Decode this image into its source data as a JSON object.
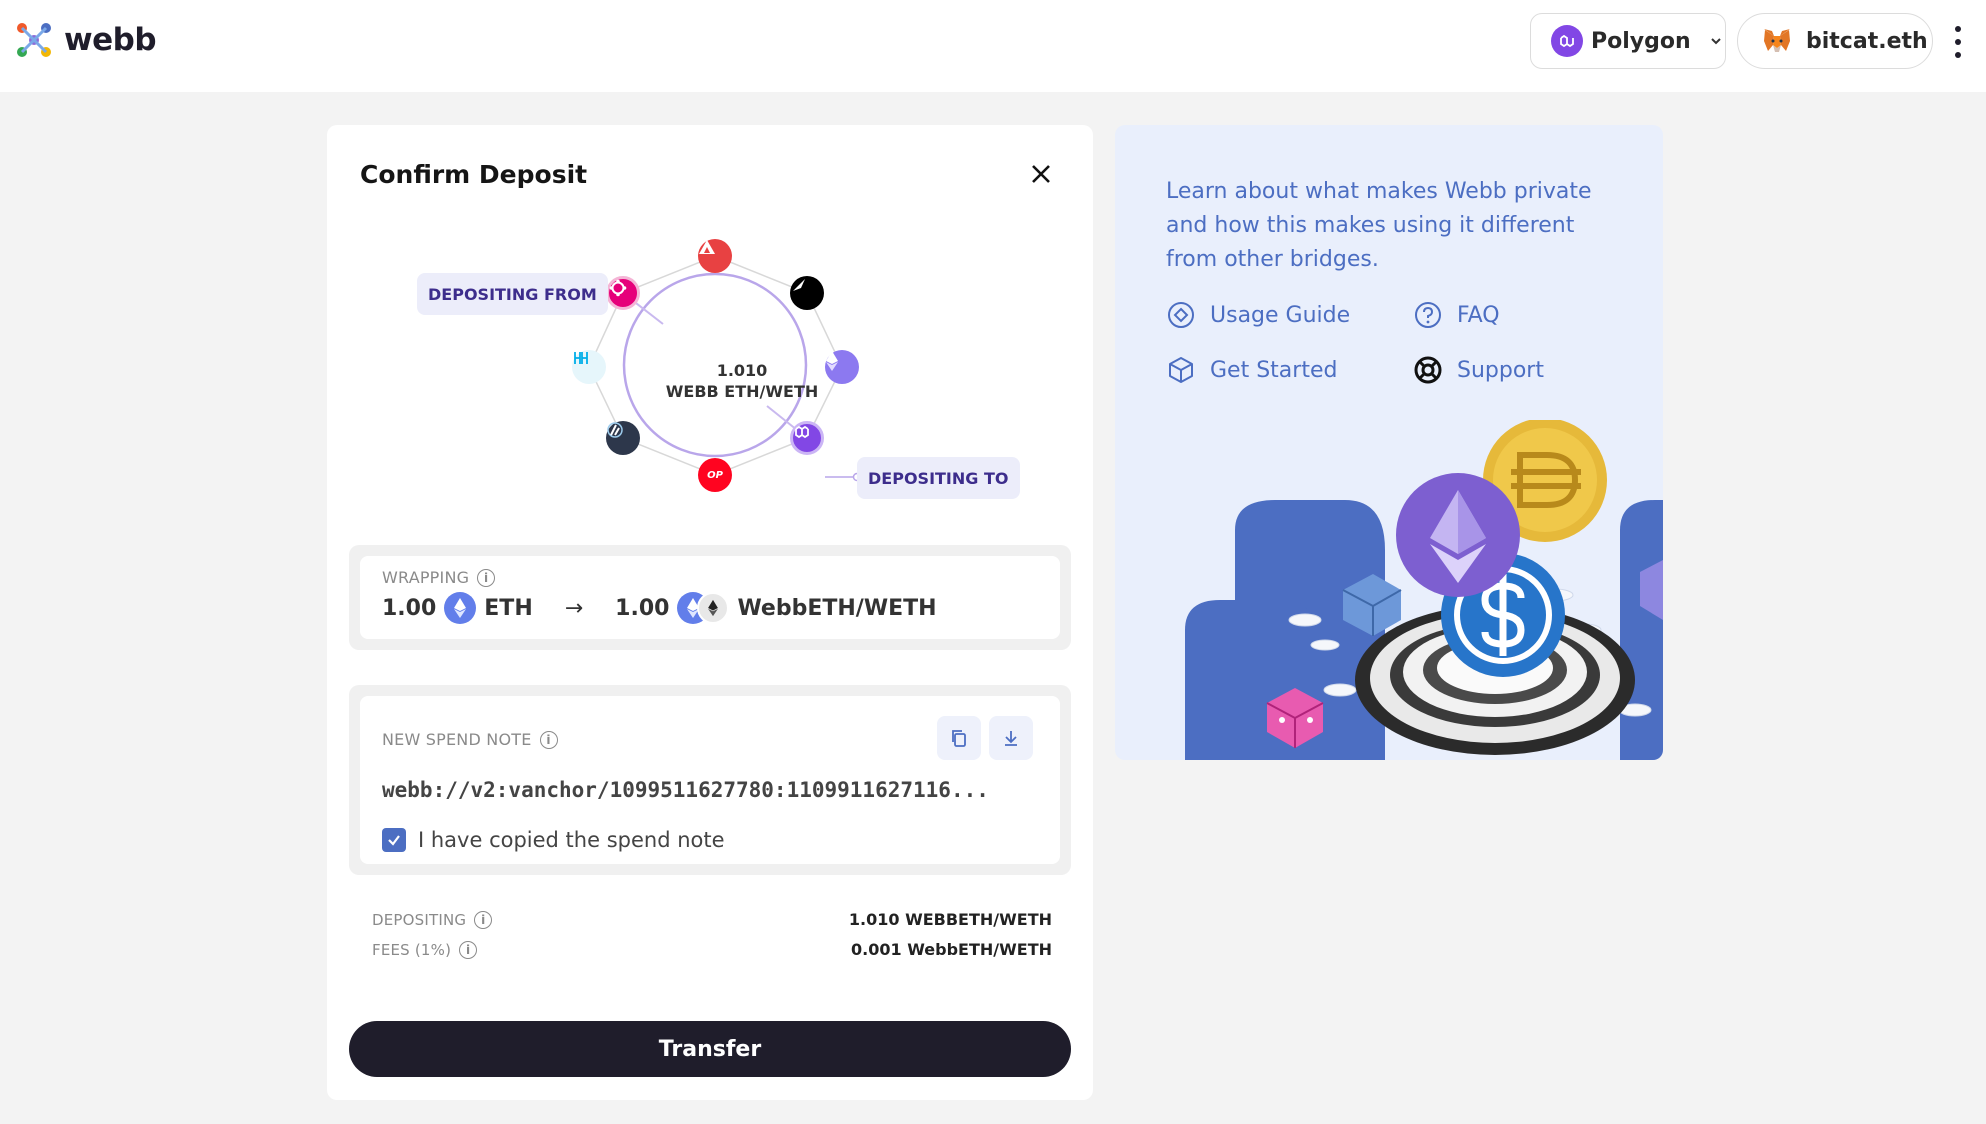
{
  "header": {
    "logo_text": "webb",
    "network": {
      "label": "Polygon",
      "icon": "polygon-icon",
      "color": "#8247e5"
    },
    "account": {
      "label": "bitcat.eth",
      "icon": "metamask-fox-icon"
    }
  },
  "modal": {
    "title": "Confirm Deposit",
    "diagram": {
      "center_amount": "1.010",
      "center_token": "WEBB ETH/WETH",
      "depositing_from_label": "DEPOSITING FROM",
      "depositing_to_label": "DEPOSITING TO",
      "chains": [
        {
          "icon": "avalanche-icon",
          "color": "#e84142"
        },
        {
          "icon": "moonbeam-icon",
          "color": "#000000"
        },
        {
          "icon": "ethereum-icon",
          "color": "#8c79f0"
        },
        {
          "icon": "polygon-icon",
          "color": "#8247e5"
        },
        {
          "icon": "optimism-icon",
          "color": "#ff0420",
          "text": "OP"
        },
        {
          "icon": "arbitrum-icon",
          "color": "#2d374b"
        },
        {
          "icon": "harmony-icon",
          "color": "#00aee9"
        },
        {
          "icon": "polkadot-icon",
          "color": "#e6007a"
        }
      ]
    },
    "wrapping": {
      "label": "WRAPPING",
      "from_amount": "1.00",
      "from_token": "ETH",
      "to_amount": "1.00",
      "to_token": "WebbETH/WETH"
    },
    "spend_note": {
      "label": "NEW SPEND NOTE",
      "value": "webb://v2:vanchor/1099511627780:1109911627116...",
      "checkbox_label": "I have copied the spend note",
      "checked": true
    },
    "summary": {
      "depositing_label": "DEPOSITING",
      "depositing_value": "1.010 WEBBETH/WETH",
      "fees_label": "FEES (1%)",
      "fees_value": "0.001 WebbETH/WETH"
    },
    "transfer_label": "Transfer"
  },
  "side_panel": {
    "text": "Learn about what makes Webb private and how this makes using it different from other bridges.",
    "links": [
      {
        "label": "Usage Guide",
        "icon": "compass-icon"
      },
      {
        "label": "FAQ",
        "icon": "question-circle-icon"
      },
      {
        "label": "Get Started",
        "icon": "cube-icon"
      },
      {
        "label": "Support",
        "icon": "lifebuoy-icon"
      }
    ]
  },
  "colors": {
    "accent_blue": "#4c6ec2",
    "dark": "#1f1d2b",
    "side_bg": "#e9effc"
  }
}
